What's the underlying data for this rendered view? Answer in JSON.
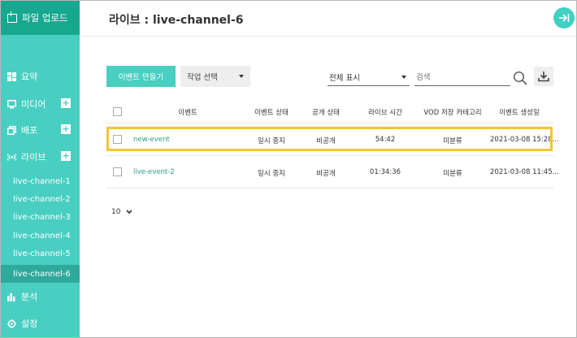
{
  "sidebar": {
    "upload_label": "파일 업로드",
    "nav": [
      {
        "label": "요약",
        "icon": "grid-icon"
      },
      {
        "label": "미디어",
        "icon": "monitor-icon",
        "has_add": true
      },
      {
        "label": "배포",
        "icon": "copy-icon",
        "has_add": true
      },
      {
        "label": "라이브",
        "icon": "broadcast-icon",
        "has_add": true
      },
      {
        "label": "분석",
        "icon": "bar-chart-icon"
      },
      {
        "label": "설정",
        "icon": "gear-icon"
      }
    ],
    "add_symbol": "+",
    "channels": [
      "live-channel-1",
      "live-channel-2",
      "live-channel-3",
      "live-channel-4",
      "live-channel-5",
      "live-channel-6"
    ],
    "active_channel": "live-channel-6"
  },
  "header": {
    "title": "라이브 : live-channel-6"
  },
  "toolbar": {
    "new_event_label": "이벤트 만들기",
    "action_select_label": "작업 선택",
    "filter_label": "전체 표시",
    "search_placeholder": "검색"
  },
  "table": {
    "columns": [
      "이벤트",
      "이벤트 상태",
      "공개 상태",
      "라이브 시간",
      "VOD 저장 카테고리",
      "이벤트 생성일"
    ],
    "rows": [
      {
        "name": "new-event",
        "status": "일시 중지",
        "visibility": "비공개",
        "duration": "54:42",
        "category": "미분류",
        "created": "2021-03-08 15:28...",
        "highlighted": true
      },
      {
        "name": "live-event-2",
        "status": "일시 중지",
        "visibility": "비공개",
        "duration": "01:34:36",
        "category": "미분류",
        "created": "2021-03-08 11:45..."
      }
    ]
  },
  "pagination": {
    "page_size": "10"
  },
  "colors": {
    "accent": "#48cfc1",
    "accent_dark": "#17a890",
    "active_item": "#2ea99c",
    "highlight": "#f5c431",
    "link": "#2e9c8e"
  }
}
